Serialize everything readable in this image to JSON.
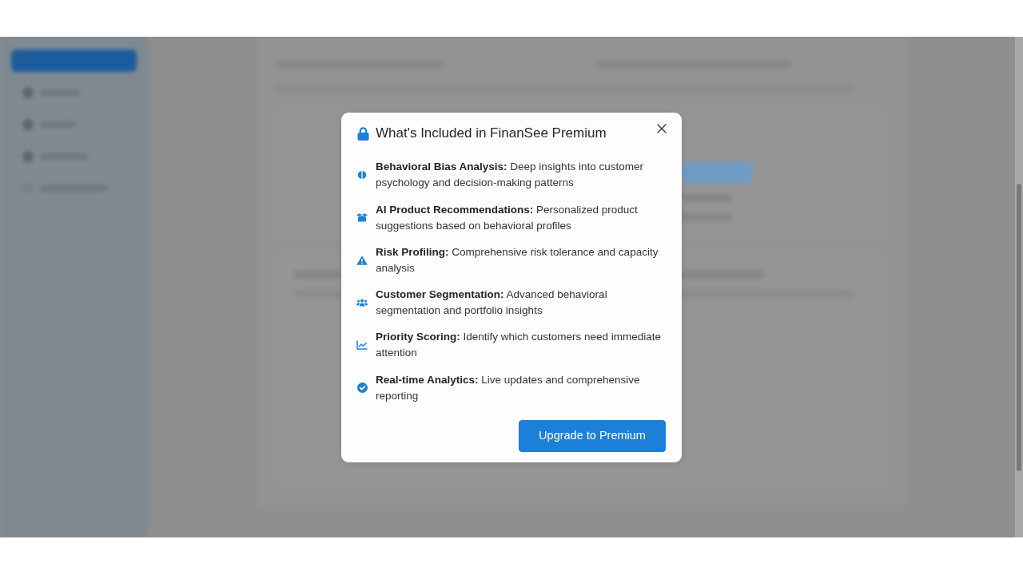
{
  "dialog": {
    "title": "What's Included in FinanSee Premium",
    "features": [
      {
        "label": "Behavioral Bias Analysis:",
        "description": "Deep insights into customer psychology and decision-making patterns"
      },
      {
        "label": "AI Product Recommendations:",
        "description": "Personalized product suggestions based on behavioral profiles"
      },
      {
        "label": "Risk Profiling:",
        "description": "Comprehensive risk tolerance and capacity analysis"
      },
      {
        "label": "Customer Segmentation:",
        "description": "Advanced behavioral segmentation and portfolio insights"
      },
      {
        "label": "Priority Scoring:",
        "description": "Identify which customers need immediate attention"
      },
      {
        "label": "Real-time Analytics:",
        "description": "Live updates and comprehensive reporting"
      }
    ],
    "button": "Upgrade to Premium"
  }
}
